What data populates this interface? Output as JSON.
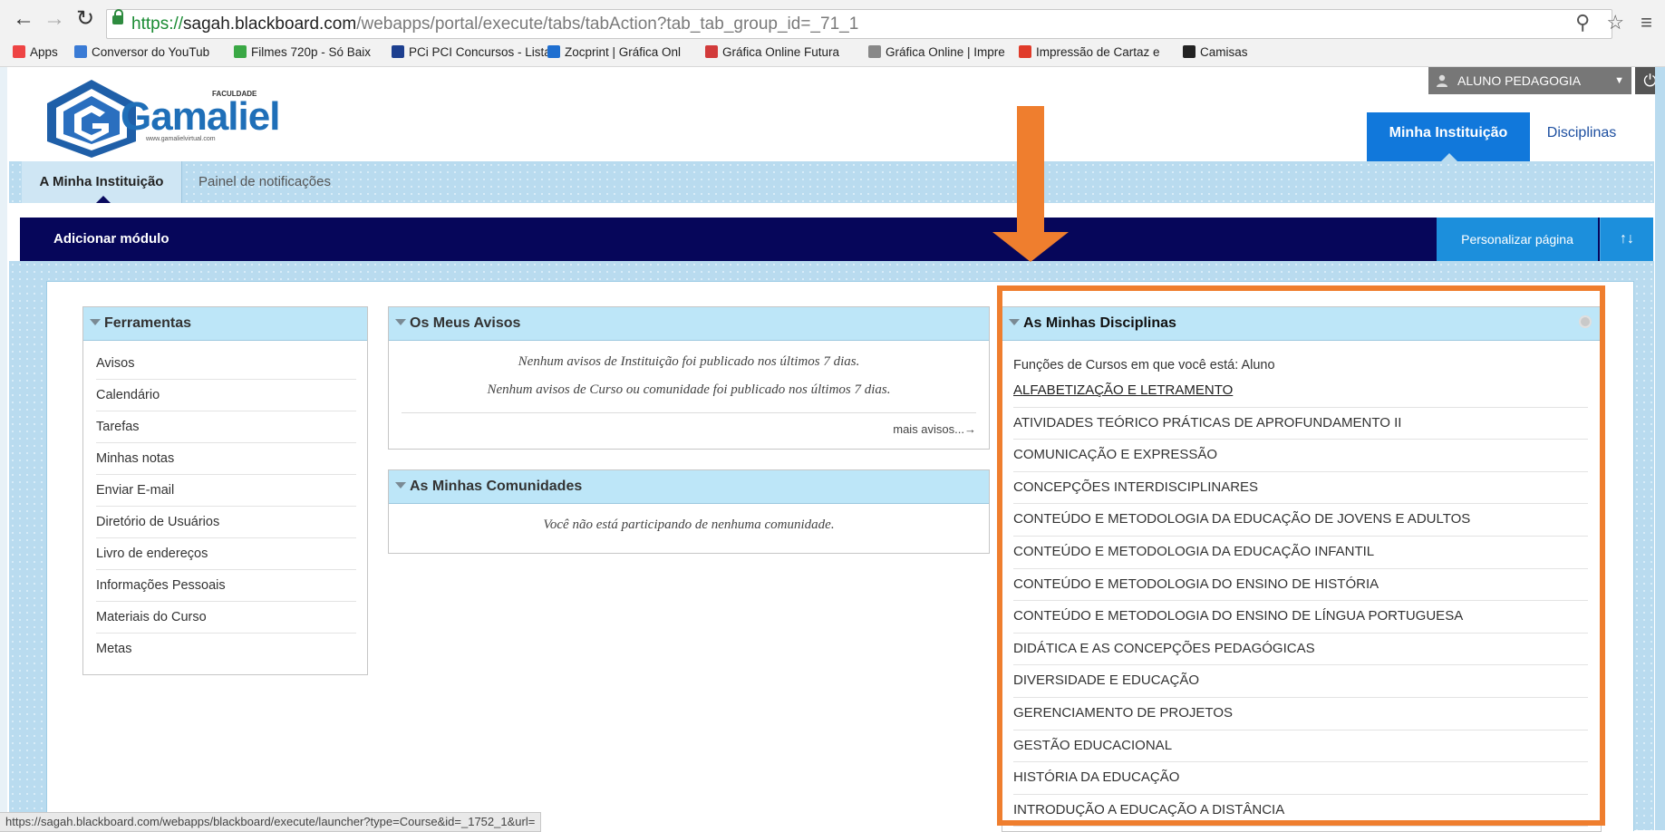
{
  "browser": {
    "back_icon": "back-arrow-icon",
    "forward_icon": "forward-arrow-icon",
    "reload_icon": "reload-icon",
    "url_scheme": "https://",
    "url_host": "sagah.blackboard.com",
    "url_path": "/webapps/portal/execute/tabs/tabAction?tab_tab_group_id=_71_1",
    "right_icons": "⚲ ☆ ≡"
  },
  "bookmarks": [
    {
      "label": "Apps",
      "icon_color": "#e44"
    },
    {
      "label": "Conversor do YouTub",
      "icon_color": "#3a7bd5"
    },
    {
      "label": "Filmes 720p - Só Baix",
      "icon_color": "#3aa845"
    },
    {
      "label": "PCi PCI Concursos - Lista",
      "icon_color": "#1d3f8f"
    },
    {
      "label": "Zocprint | Gráfica Onl",
      "icon_color": "#1f6fd0"
    },
    {
      "label": "Gráfica Online Futura",
      "icon_color": "#d23b3b"
    },
    {
      "label": "Gráfica Online | Impre",
      "icon_color": "#888"
    },
    {
      "label": "Impressão de Cartaz e",
      "icon_color": "#e03b2a"
    },
    {
      "label": "Camisas",
      "icon_color": "#222"
    }
  ],
  "header": {
    "logo_brand": "Gamaliel",
    "logo_prefix": "FACULDADE",
    "logo_url": "www.gamalielvirtual.com",
    "user_name": "ALUNO PEDAGOGIA",
    "user_dropdown": "▼",
    "logout_icon": "⏻",
    "tabs": [
      {
        "label": "Minha Instituição",
        "active": true
      },
      {
        "label": "Disciplinas",
        "active": false
      }
    ]
  },
  "subnav": {
    "tabs": [
      {
        "label": "A Minha Instituição",
        "active": true
      },
      {
        "label": "Painel de notificações",
        "active": false
      }
    ]
  },
  "module_bar": {
    "add_module": "Adicionar módulo",
    "personalize": "Personalizar página",
    "sort_icon": "↑↓"
  },
  "modules": {
    "tools": {
      "title": "Ferramentas",
      "items": [
        "Avisos",
        "Calendário",
        "Tarefas",
        "Minhas notas",
        "Enviar E-mail",
        "Diretório de Usuários",
        "Livro de endereços",
        "Informações Pessoais",
        "Materiais do Curso",
        "Metas"
      ]
    },
    "avisos": {
      "title": "Os Meus Avisos",
      "line1": "Nenhum avisos de Instituição foi publicado nos últimos 7 dias.",
      "line2": "Nenhum avisos de Curso ou comunidade foi publicado nos últimos 7 dias.",
      "more": "mais avisos...→"
    },
    "communities": {
      "title": "As Minhas Comunidades",
      "empty": "Você não está participando de nenhuma comunidade."
    },
    "courses": {
      "title": "As Minhas Disciplinas",
      "roles_label": "Funções de Cursos em que você está: Aluno",
      "items": [
        "ALFABETIZAÇÃO E LETRAMENTO",
        "ATIVIDADES TEÓRICO PRÁTICAS DE APROFUNDAMENTO II",
        "COMUNICAÇÃO E EXPRESSÃO",
        "CONCEPÇÕES INTERDISCIPLINARES",
        "CONTEÚDO E METODOLOGIA DA EDUCAÇÃO DE JOVENS E ADULTOS",
        "CONTEÚDO E METODOLOGIA DA EDUCAÇÃO INFANTIL",
        "CONTEÚDO E METODOLOGIA DO ENSINO DE HISTÓRIA",
        "CONTEÚDO E METODOLOGIA DO ENSINO DE LÍNGUA PORTUGUESA",
        "DIDÁTICA E AS CONCEPÇÕES PEDAGÓGICAS",
        "DIVERSIDADE E EDUCAÇÃO",
        "GERENCIAMENTO DE PROJETOS",
        "GESTÃO EDUCACIONAL",
        "HISTÓRIA DA EDUCAÇÃO",
        "INTRODUÇÃO A EDUCAÇÃO A DISTÂNCIA"
      ]
    }
  },
  "status_url": "https://sagah.blackboard.com/webapps/blackboard/execute/launcher?type=Course&id=_1752_1&url=",
  "colors": {
    "accent": "#ef7e2e",
    "nav_blue": "#1178db",
    "module_bar": "#06065a"
  }
}
